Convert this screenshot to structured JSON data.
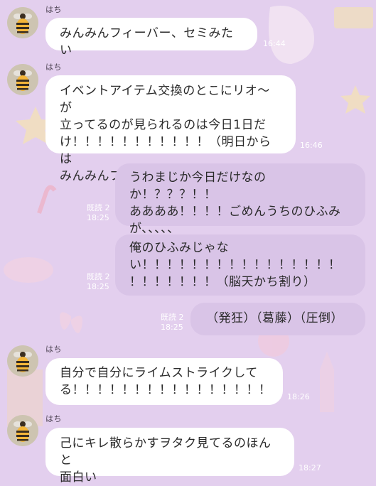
{
  "chat": {
    "sender_name": "はち",
    "messages": [
      {
        "dir": "in",
        "text": "みんみんフィーバー、セミみたい",
        "time": "16:44"
      },
      {
        "dir": "in",
        "text": "イベントアイテム交換のとこにリオ〜が\n立ってるのが見られるのは今日1日だ\nけ！！！！！！！！！！！（明日からは\nみんみんフィーバーなので）",
        "time": "16:46"
      },
      {
        "dir": "out",
        "text": "うわまじか今日だけなのか！？？？！！\nああああ！！！！ごめんうちのひふみ\nが、、、、、",
        "read": "既読 2",
        "time": "18:25"
      },
      {
        "dir": "out",
        "text": "俺のひふみじゃな\nい！！！！！！！！！！！！！！！！\n！！！！！！！（脳天かち割り）",
        "read": "既読 2",
        "time": "18:25"
      },
      {
        "dir": "out",
        "text": "（発狂）（葛藤）（圧倒）",
        "read": "既読 2",
        "time": "18:25"
      },
      {
        "dir": "in",
        "text": "自分で自分にライムストライクして\nる！！！！！！！！！！！！！！！！",
        "time": "18:26"
      },
      {
        "dir": "in",
        "text": "己にキレ散らかすヲタク見てるのほんと\n面白い",
        "time": "18:27"
      }
    ]
  },
  "colors": {
    "background": "#e3cfee",
    "incoming_bubble": "#ffffff",
    "outgoing_bubble": "#d9c4e7"
  }
}
